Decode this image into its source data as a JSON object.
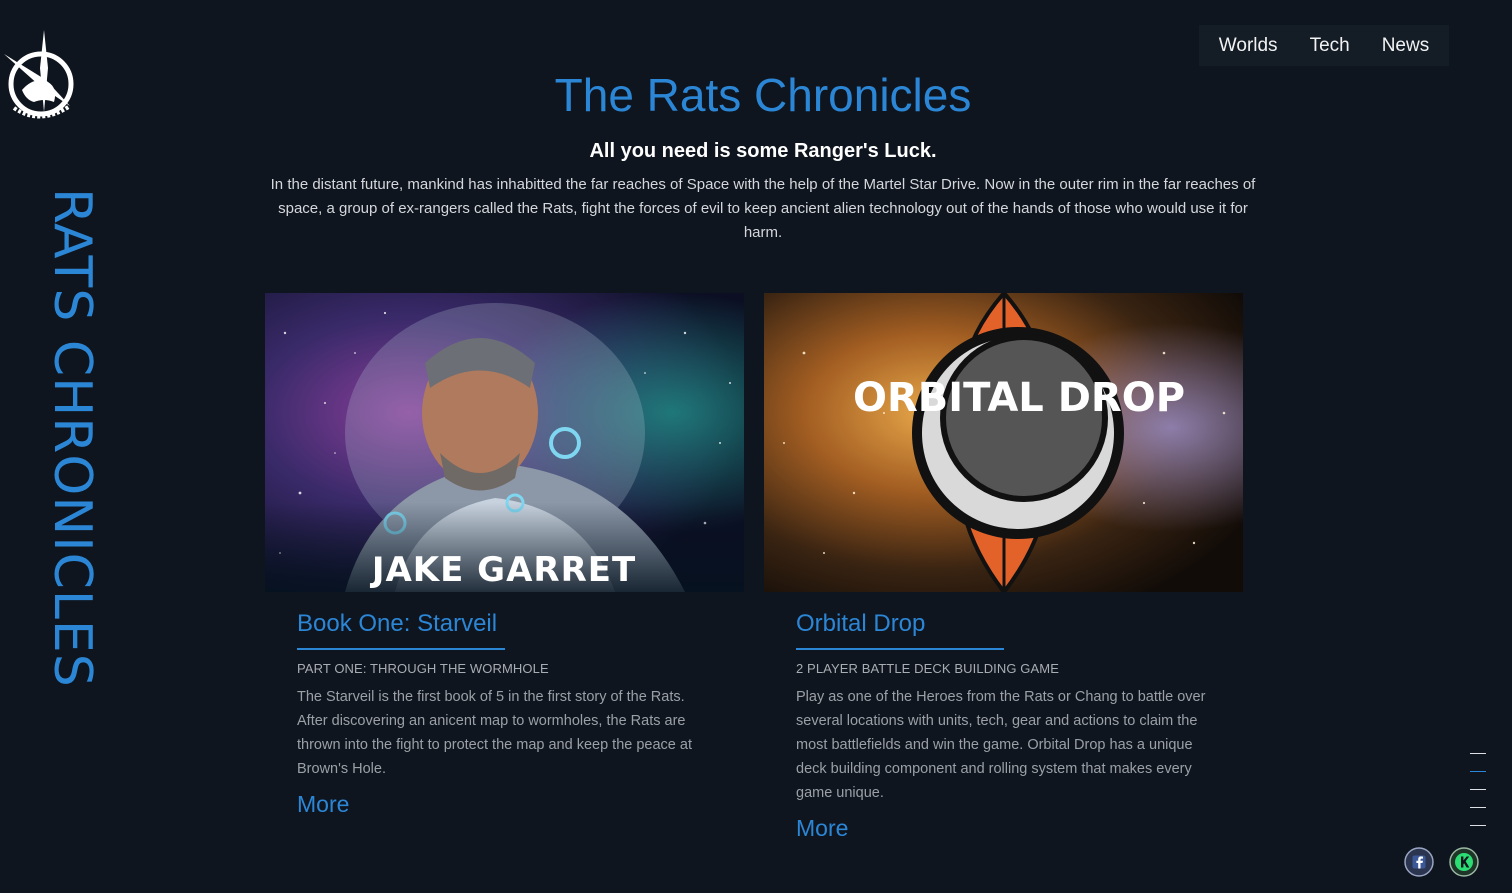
{
  "brand": {
    "vertical_title": "RATS CHRONICLES",
    "logo_icon": "rats-emblem-logo"
  },
  "nav": {
    "items": [
      {
        "label": "Worlds"
      },
      {
        "label": "Tech"
      },
      {
        "label": "News"
      }
    ]
  },
  "hero": {
    "title": "The Rats Chronicles",
    "tagline": "All you need is some Ranger's Luck.",
    "intro": "In the distant future, mankind has inhabitted the far reaches of Space with the help of the Martel Star Drive. Now in the outer rim in the far reaches of space, a group of ex-rangers called the Rats, fight the forces of evil to keep ancient alien technology out of the hands of those who would use it for harm."
  },
  "cards": [
    {
      "image_caption": "JAKE GARRET",
      "title": "Book One: Starveil",
      "subtitle": "PART ONE: THROUGH THE WORMHOLE",
      "description": "The Starveil is the first book of 5 in the first story of the Rats. After discovering an anicent map to wormholes, the Rats are thrown into the fight to protect the map and keep the peace at Brown's Hole.",
      "more_label": "More"
    },
    {
      "image_caption": "ORBITAL DROP",
      "title": "Orbital Drop",
      "subtitle": "2 PLAYER BATTLE DECK BUILDING GAME",
      "description": "Play as one of the Heroes from the Rats or Chang to battle over several locations with units, tech, gear and actions to claim the most battlefields and win the game. Orbital Drop has a unique deck building component and rolling system that makes every game unique.",
      "more_label": "More"
    }
  ],
  "side_nav": {
    "count": 5,
    "active_index": 1
  },
  "social": {
    "facebook_icon": "facebook-icon",
    "kickstarter_icon": "kickstarter-icon"
  },
  "colors": {
    "background": "#0f151e",
    "accent": "#2c86d6",
    "nav_bg": "#141c26"
  }
}
